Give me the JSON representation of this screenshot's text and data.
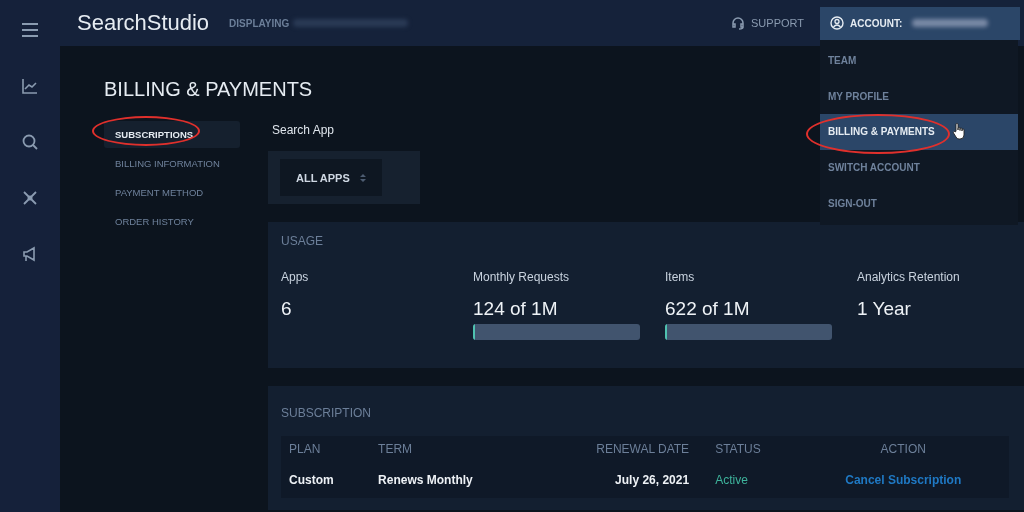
{
  "topbar": {
    "brand": "SearchStudio",
    "displaying_label": "DISPLAYING",
    "support": "SUPPORT",
    "account_label": "ACCOUNT:"
  },
  "account_menu": {
    "items": [
      {
        "label": "TEAM",
        "selected": false,
        "circled": false
      },
      {
        "label": "MY PROFILE",
        "selected": false,
        "circled": false
      },
      {
        "label": "BILLING & PAYMENTS",
        "selected": true,
        "circled": true
      },
      {
        "label": "SWITCH ACCOUNT",
        "selected": false,
        "circled": false
      },
      {
        "label": "SIGN-OUT",
        "selected": false,
        "circled": false
      }
    ]
  },
  "page_title": "BILLING & PAYMENTS",
  "subnav": [
    {
      "label": "SUBSCRIPTIONS",
      "selected": true,
      "circled": true
    },
    {
      "label": "BILLING INFORMATION",
      "selected": false,
      "circled": false
    },
    {
      "label": "PAYMENT METHOD",
      "selected": false,
      "circled": false
    },
    {
      "label": "ORDER HISTORY",
      "selected": false,
      "circled": false
    }
  ],
  "search_app": {
    "label": "Search App",
    "select_value": "ALL APPS"
  },
  "usage": {
    "title": "USAGE",
    "stats": [
      {
        "label": "Apps",
        "value": "6"
      },
      {
        "label": "Monthly Requests",
        "value": "124 of 1M",
        "level": 0.01
      },
      {
        "label": "Items",
        "value": "622 of 1M",
        "level": 0.01
      },
      {
        "label": "Analytics Retention",
        "value": "1 Year"
      }
    ]
  },
  "subscription": {
    "title": "SUBSCRIPTION",
    "columns": [
      "PLAN",
      "TERM",
      "RENEWAL DATE",
      "STATUS",
      "ACTION"
    ],
    "rows": [
      {
        "plan": "Custom",
        "term": "Renews Monthly",
        "renewal_date": "July 26, 2021",
        "status": "Active",
        "action": "Cancel Subscription"
      }
    ]
  }
}
